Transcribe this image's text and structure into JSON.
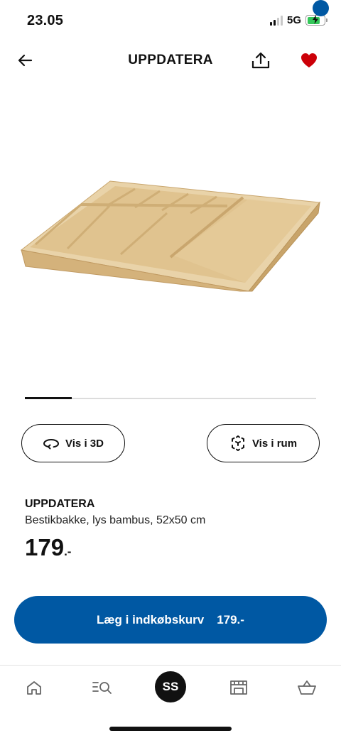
{
  "status_bar": {
    "time": "23.05",
    "network": "5G",
    "battery_color": "#34c759"
  },
  "nav": {
    "title": "UPPDATERA",
    "back_icon": "arrow-left-icon",
    "share_icon": "share-icon",
    "favorite_icon": "heart-icon",
    "favorite_color": "#cc0008"
  },
  "gallery": {
    "image_icon": "cutlery-tray-image",
    "progress": 0.16
  },
  "actions": {
    "view_3d_label": "Vis i 3D",
    "view_in_room_label": "Vis i rum"
  },
  "product": {
    "name": "UPPDATERA",
    "description": "Bestikbakke, lys bambus, 52x50 cm",
    "price_main": "179",
    "price_suffix": ".-"
  },
  "cart_button": {
    "label": "Læg i indkøbskurv",
    "price": "179.-",
    "color": "#0058a3"
  },
  "tab_bar": {
    "home_icon": "home-icon",
    "search_icon": "search-list-icon",
    "profile_initials": "SS",
    "store_icon": "store-icon",
    "cart_icon": "basket-icon",
    "cart_badge_color": "#0058a3"
  }
}
